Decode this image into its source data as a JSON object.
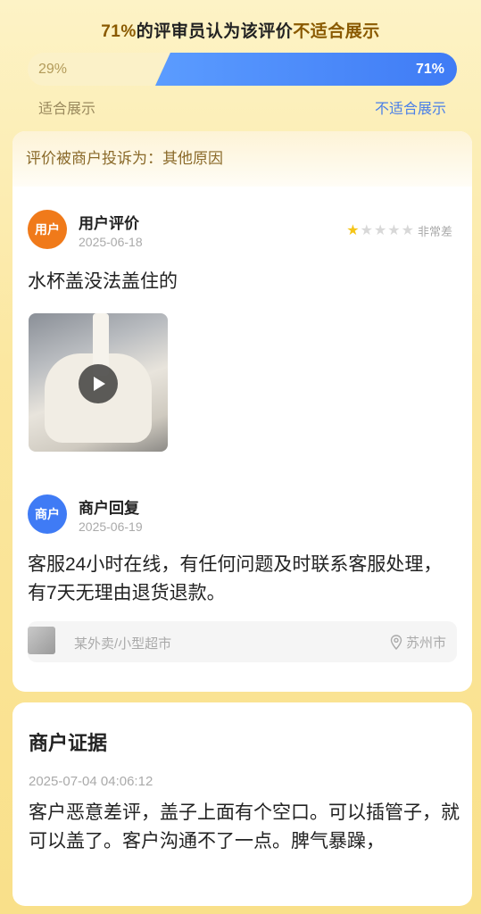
{
  "verdict": {
    "percent": "71%",
    "middle": "的评审员认为该评价",
    "tail": "不适合展示"
  },
  "vote": {
    "left_percent": "29%",
    "right_percent": "71%",
    "left_label": "适合展示",
    "right_label": "不适合展示"
  },
  "review_card": {
    "complaint": "评价被商户投诉为：其他原因",
    "user": {
      "avatar_label": "用户",
      "name": "用户评价",
      "date": "2025-06-18",
      "rating_stars": 1,
      "rating_max": 5,
      "rating_text": "非常差",
      "text": "水杯盖没法盖住的"
    },
    "merchant": {
      "avatar_label": "商户",
      "name": "商户回复",
      "date": "2025-06-19",
      "text": "客服24小时在线，有任何问题及时联系客服处理，有7天无理由退货退款。"
    },
    "shop": {
      "name": "某外卖/小型超市",
      "location": "苏州市"
    }
  },
  "evidence_card": {
    "title": "商户证据",
    "date": "2025-07-04 04:06:12",
    "text": "客户恶意差评，盖子上面有个空口。可以插管子，就可以盖了。客户沟通不了一点。脾气暴躁，"
  },
  "colors": {
    "user_avatar": "#f07a1a",
    "merchant_avatar": "#3f7bf5",
    "vote_bar": "#3f7bf5",
    "star": "#f5c518"
  }
}
